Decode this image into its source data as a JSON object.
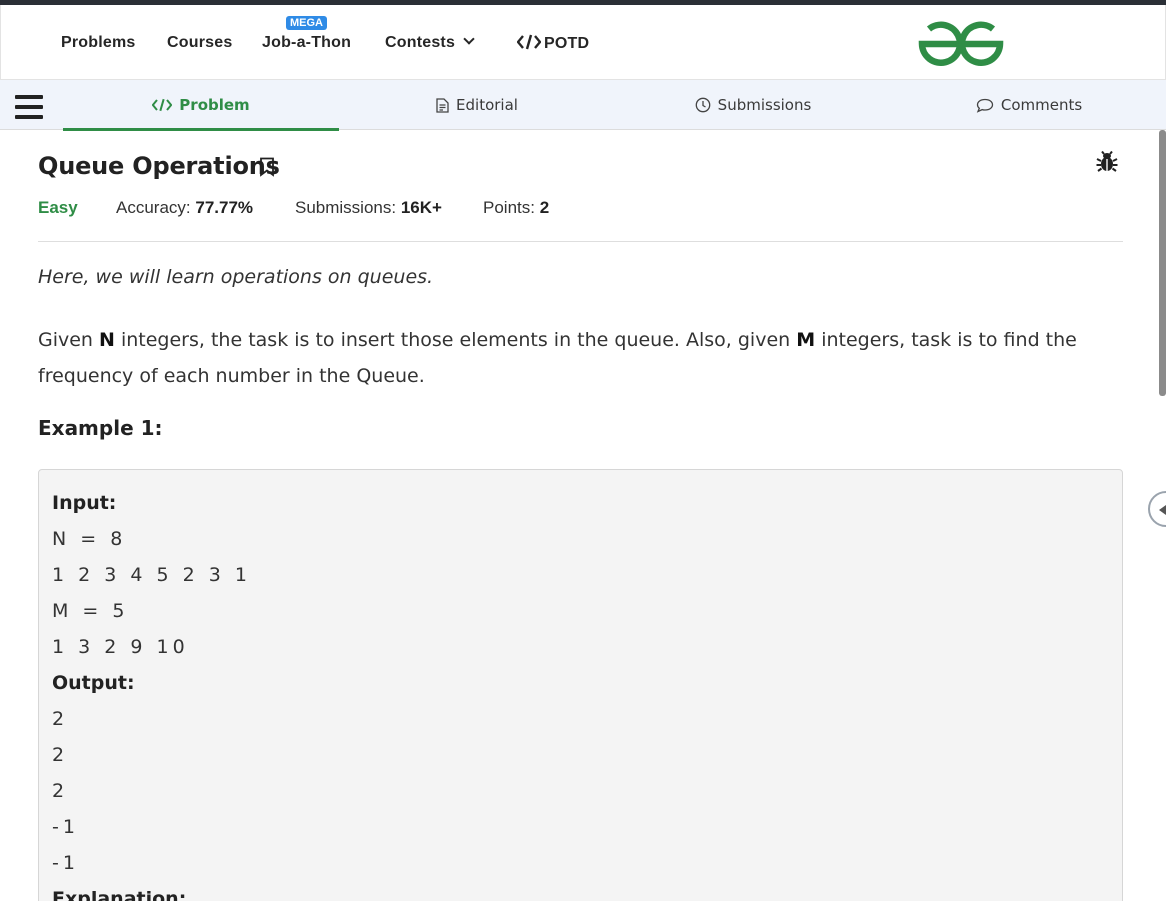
{
  "nav": {
    "items": [
      "Problems",
      "Courses",
      "Job-a-Thon",
      "Contests",
      "POTD"
    ],
    "mega_badge": "MEGA",
    "brand_color": "#2f8d46"
  },
  "tabs": [
    {
      "label": "Problem",
      "icon": "code-icon",
      "active": true
    },
    {
      "label": "Editorial",
      "icon": "document-icon",
      "active": false
    },
    {
      "label": "Submissions",
      "icon": "clock-icon",
      "active": false
    },
    {
      "label": "Comments",
      "icon": "comment-icon",
      "active": false
    }
  ],
  "problem": {
    "title": "Queue Operations",
    "difficulty": "Easy",
    "accuracy_label": "Accuracy: ",
    "accuracy_value": "77.77%",
    "submissions_label": "Submissions: ",
    "submissions_value": "16K+",
    "points_label": "Points: ",
    "points_value": "2"
  },
  "content": {
    "intro": "Here, we will learn operations on queues.",
    "para_1": "Given ",
    "para_n": "N",
    "para_2": " integers, the task is to insert those elements in the queue. Also, given ",
    "para_m": "M",
    "para_3": " integers, task is to find the frequency of each number in the Queue.",
    "example_title": "Example 1:",
    "input_label": "Input:",
    "input_lines": [
      "N = 8",
      "1 2 3 4 5 2 3 1",
      "M = 5",
      "1 3 2 9 10"
    ],
    "output_label": "Output:",
    "output_lines": [
      "2",
      "2",
      "2",
      "-1",
      "-1"
    ],
    "explanation_label": "Explanation:"
  }
}
